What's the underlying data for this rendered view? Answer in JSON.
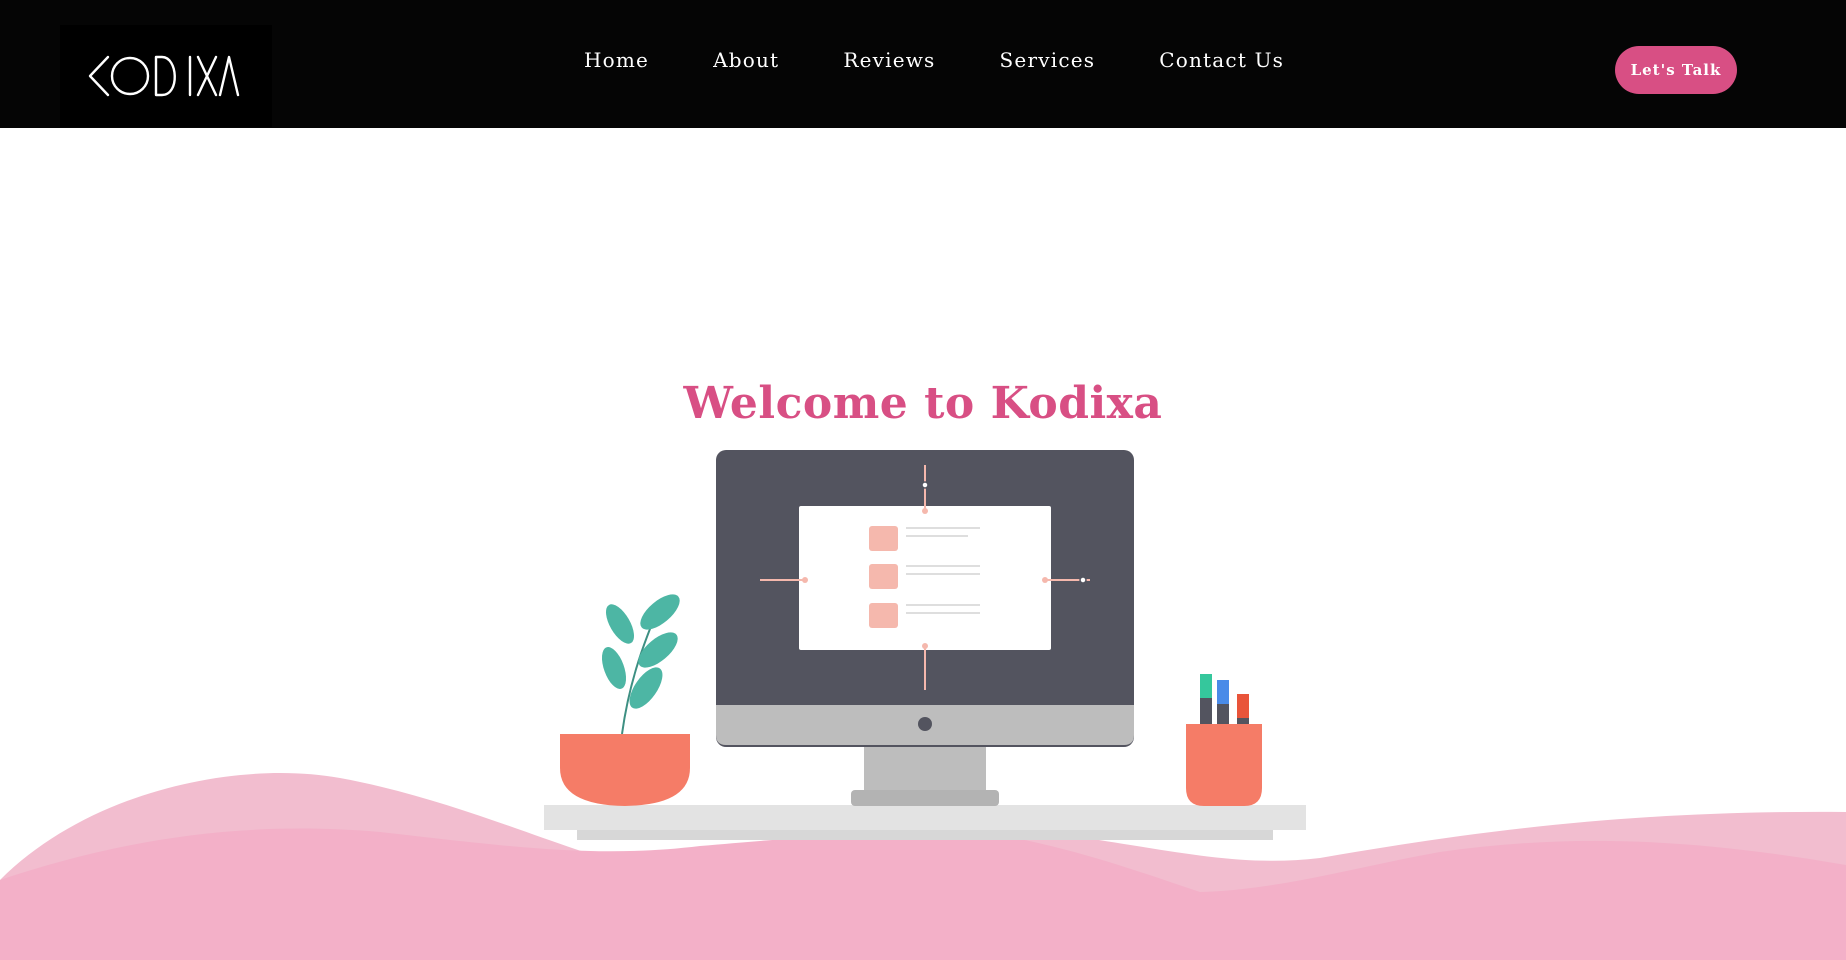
{
  "brand": {
    "logo_text": "KODIXA"
  },
  "nav": {
    "items": [
      {
        "label": "Home"
      },
      {
        "label": "About"
      },
      {
        "label": "Reviews"
      },
      {
        "label": "Services"
      },
      {
        "label": "Contact Us"
      }
    ],
    "cta_label": "Let's Talk"
  },
  "hero": {
    "title": "Welcome to Kodixa"
  },
  "colors": {
    "nav_background": "#050505",
    "accent": "#d84f84",
    "wave_light": "#f2bdcf",
    "wave": "#f3b0c8",
    "monitor": "#53545f",
    "coral": "#f57c67",
    "leaf": "#4db6a4"
  }
}
